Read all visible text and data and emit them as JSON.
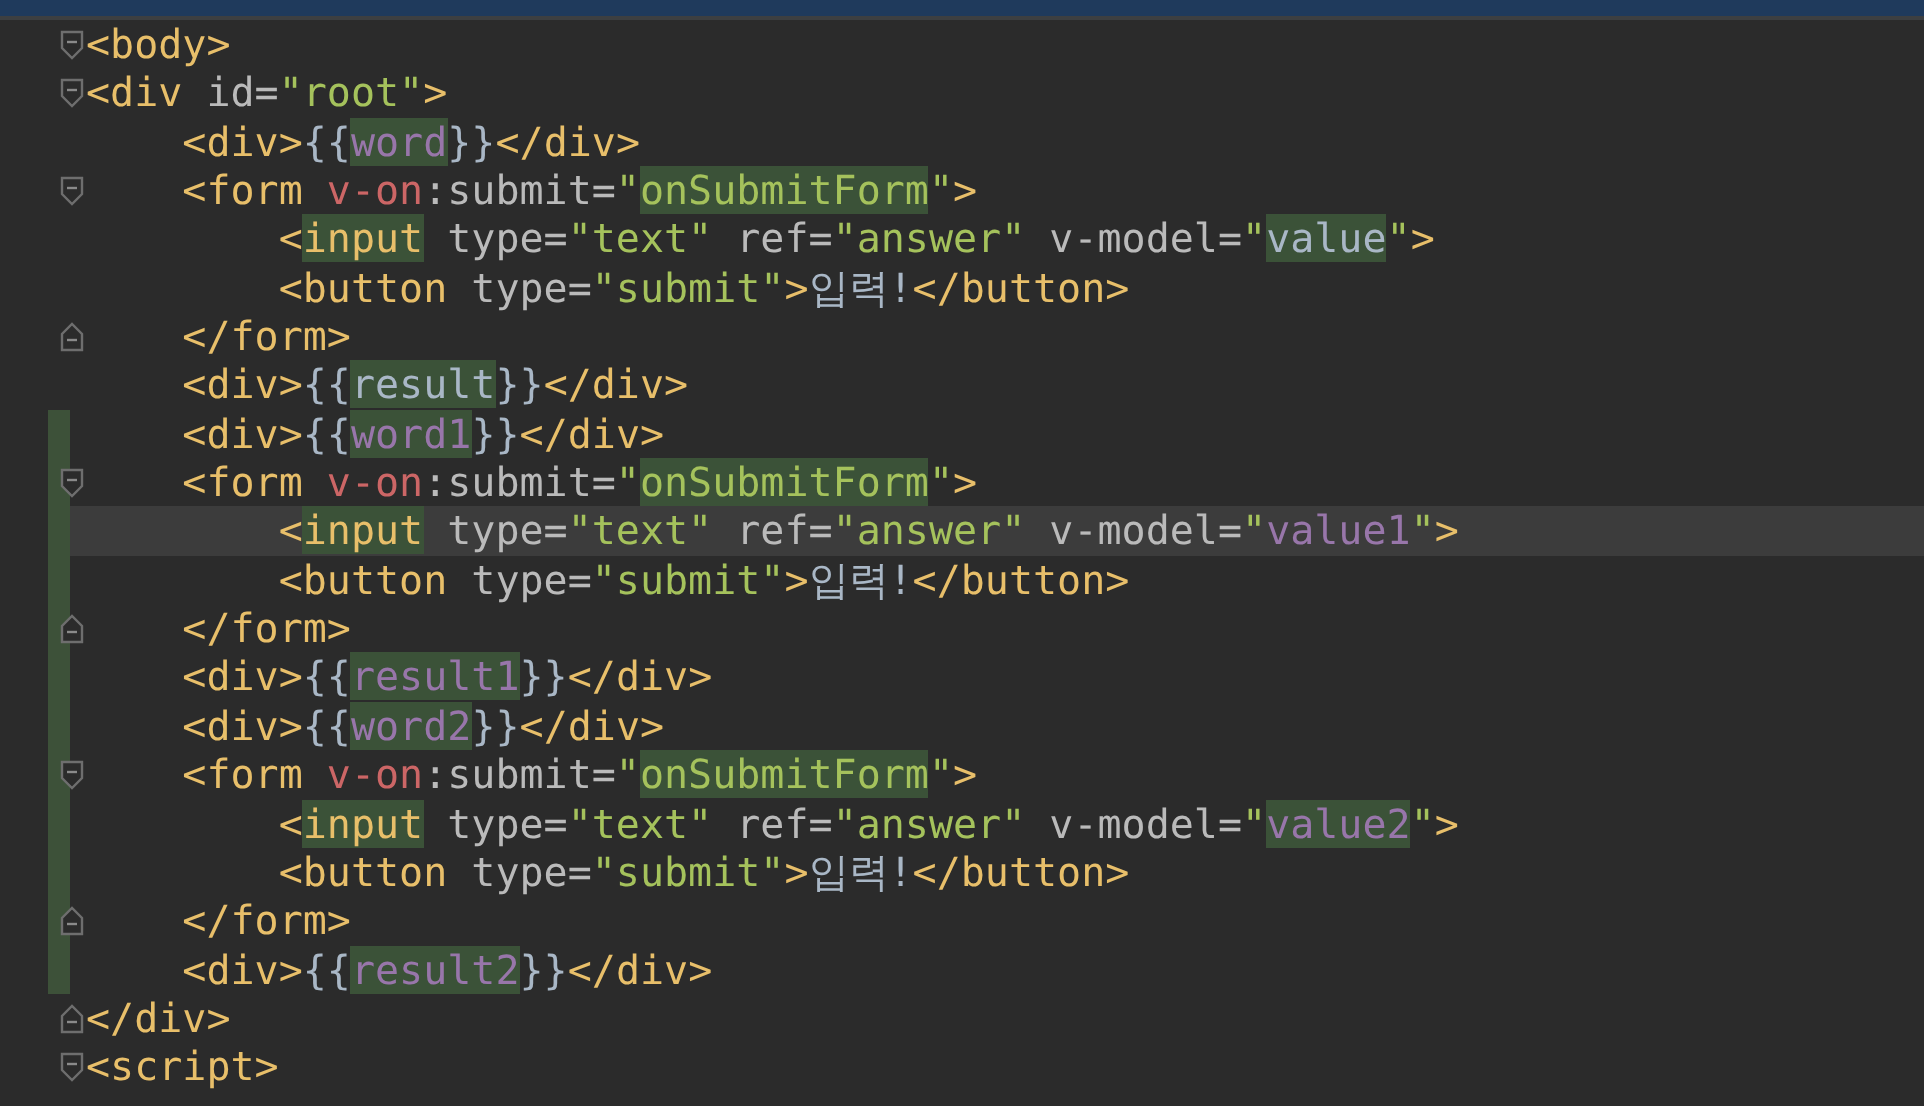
{
  "editor": {
    "lines": [
      {
        "fold_start": true,
        "fold_end": false,
        "changed": false,
        "current": false,
        "tokens": [
          {
            "kind": "tag",
            "text": "<body>"
          }
        ]
      },
      {
        "fold_start": true,
        "fold_end": false,
        "changed": false,
        "current": false,
        "tokens": [
          {
            "kind": "tag",
            "text": "<div "
          },
          {
            "kind": "attr",
            "text": "id="
          },
          {
            "kind": "string",
            "text": "\"root\""
          },
          {
            "kind": "tag",
            "text": ">"
          }
        ]
      },
      {
        "fold_start": false,
        "fold_end": false,
        "changed": false,
        "current": false,
        "tokens": [
          {
            "kind": "tag",
            "text": "    <div>"
          },
          {
            "kind": "plain",
            "text": "{{"
          },
          {
            "kind": "var",
            "text": "word",
            "highlighted": true
          },
          {
            "kind": "plain",
            "text": "}}"
          },
          {
            "kind": "tag",
            "text": "</div>"
          }
        ]
      },
      {
        "fold_start": true,
        "fold_end": false,
        "changed": false,
        "current": false,
        "tokens": [
          {
            "kind": "tag",
            "text": "    <form "
          },
          {
            "kind": "directive",
            "text": "v-on"
          },
          {
            "kind": "attr",
            "text": ":submit="
          },
          {
            "kind": "string",
            "text": "\""
          },
          {
            "kind": "string",
            "text": "onSubmitForm",
            "highlighted": true
          },
          {
            "kind": "string",
            "text": "\""
          },
          {
            "kind": "tag",
            "text": ">"
          }
        ]
      },
      {
        "fold_start": false,
        "fold_end": false,
        "changed": false,
        "current": false,
        "tokens": [
          {
            "kind": "tag",
            "text": "        <"
          },
          {
            "kind": "tag",
            "text": "input",
            "highlighted": true
          },
          {
            "kind": "attr",
            "text": " type="
          },
          {
            "kind": "string",
            "text": "\"text\""
          },
          {
            "kind": "attr",
            "text": " ref="
          },
          {
            "kind": "string",
            "text": "\"answer\""
          },
          {
            "kind": "attr",
            "text": " v-model="
          },
          {
            "kind": "string",
            "text": "\""
          },
          {
            "kind": "plain",
            "text": "value",
            "highlighted": true
          },
          {
            "kind": "string",
            "text": "\""
          },
          {
            "kind": "tag",
            "text": ">"
          }
        ]
      },
      {
        "fold_start": false,
        "fold_end": false,
        "changed": false,
        "current": false,
        "tokens": [
          {
            "kind": "tag",
            "text": "        <button "
          },
          {
            "kind": "attr",
            "text": "type="
          },
          {
            "kind": "string",
            "text": "\"submit\""
          },
          {
            "kind": "tag",
            "text": ">"
          },
          {
            "kind": "plain",
            "text": "입력!"
          },
          {
            "kind": "tag",
            "text": "</button>"
          }
        ]
      },
      {
        "fold_start": false,
        "fold_end": true,
        "changed": false,
        "current": false,
        "tokens": [
          {
            "kind": "tag",
            "text": "    </form>"
          }
        ]
      },
      {
        "fold_start": false,
        "fold_end": false,
        "changed": false,
        "current": false,
        "tokens": [
          {
            "kind": "tag",
            "text": "    <div>"
          },
          {
            "kind": "plain",
            "text": "{{"
          },
          {
            "kind": "plain",
            "text": "result",
            "highlighted": true
          },
          {
            "kind": "plain",
            "text": "}}"
          },
          {
            "kind": "tag",
            "text": "</div>"
          }
        ]
      },
      {
        "fold_start": false,
        "fold_end": false,
        "changed": true,
        "current": false,
        "tokens": [
          {
            "kind": "tag",
            "text": "    <div>"
          },
          {
            "kind": "plain",
            "text": "{{"
          },
          {
            "kind": "var",
            "text": "word1",
            "highlighted": true
          },
          {
            "kind": "plain",
            "text": "}}"
          },
          {
            "kind": "tag",
            "text": "</div>"
          }
        ]
      },
      {
        "fold_start": true,
        "fold_end": false,
        "changed": true,
        "current": false,
        "tokens": [
          {
            "kind": "tag",
            "text": "    <form "
          },
          {
            "kind": "directive",
            "text": "v-on"
          },
          {
            "kind": "attr",
            "text": ":submit="
          },
          {
            "kind": "string",
            "text": "\""
          },
          {
            "kind": "string",
            "text": "onSubmitForm",
            "highlighted": true
          },
          {
            "kind": "string",
            "text": "\""
          },
          {
            "kind": "tag",
            "text": ">"
          }
        ]
      },
      {
        "fold_start": false,
        "fold_end": false,
        "changed": true,
        "current": true,
        "tokens": [
          {
            "kind": "tag",
            "text": "        <"
          },
          {
            "kind": "tag",
            "text": "input",
            "highlighted": true
          },
          {
            "kind": "attr",
            "text": " type="
          },
          {
            "kind": "string",
            "text": "\"text\""
          },
          {
            "kind": "attr",
            "text": " ref="
          },
          {
            "kind": "string",
            "text": "\"answer\""
          },
          {
            "kind": "attr",
            "text": " v-model="
          },
          {
            "kind": "string",
            "text": "\""
          },
          {
            "kind": "var",
            "text": "value1"
          },
          {
            "kind": "string",
            "text": "\""
          },
          {
            "kind": "tag",
            "text": ">"
          }
        ]
      },
      {
        "fold_start": false,
        "fold_end": false,
        "changed": true,
        "current": false,
        "tokens": [
          {
            "kind": "tag",
            "text": "        <button "
          },
          {
            "kind": "attr",
            "text": "type="
          },
          {
            "kind": "string",
            "text": "\"submit\""
          },
          {
            "kind": "tag",
            "text": ">"
          },
          {
            "kind": "plain",
            "text": "입력!"
          },
          {
            "kind": "tag",
            "text": "</button>"
          }
        ]
      },
      {
        "fold_start": false,
        "fold_end": true,
        "changed": true,
        "current": false,
        "tokens": [
          {
            "kind": "tag",
            "text": "    </form>"
          }
        ]
      },
      {
        "fold_start": false,
        "fold_end": false,
        "changed": true,
        "current": false,
        "tokens": [
          {
            "kind": "tag",
            "text": "    <div>"
          },
          {
            "kind": "plain",
            "text": "{{"
          },
          {
            "kind": "var",
            "text": "result1",
            "highlighted": true
          },
          {
            "kind": "plain",
            "text": "}}"
          },
          {
            "kind": "tag",
            "text": "</div>"
          }
        ]
      },
      {
        "fold_start": false,
        "fold_end": false,
        "changed": true,
        "current": false,
        "tokens": [
          {
            "kind": "tag",
            "text": "    <div>"
          },
          {
            "kind": "plain",
            "text": "{{"
          },
          {
            "kind": "var",
            "text": "word2",
            "highlighted": true
          },
          {
            "kind": "plain",
            "text": "}}"
          },
          {
            "kind": "tag",
            "text": "</div>"
          }
        ]
      },
      {
        "fold_start": true,
        "fold_end": false,
        "changed": true,
        "current": false,
        "tokens": [
          {
            "kind": "tag",
            "text": "    <form "
          },
          {
            "kind": "directive",
            "text": "v-on"
          },
          {
            "kind": "attr",
            "text": ":submit="
          },
          {
            "kind": "string",
            "text": "\""
          },
          {
            "kind": "string",
            "text": "onSubmitForm",
            "highlighted": true
          },
          {
            "kind": "string",
            "text": "\""
          },
          {
            "kind": "tag",
            "text": ">"
          }
        ]
      },
      {
        "fold_start": false,
        "fold_end": false,
        "changed": true,
        "current": false,
        "tokens": [
          {
            "kind": "tag",
            "text": "        <"
          },
          {
            "kind": "tag",
            "text": "input",
            "highlighted": true
          },
          {
            "kind": "attr",
            "text": " type="
          },
          {
            "kind": "string",
            "text": "\"text\""
          },
          {
            "kind": "attr",
            "text": " ref="
          },
          {
            "kind": "string",
            "text": "\"answer\""
          },
          {
            "kind": "attr",
            "text": " v-model="
          },
          {
            "kind": "string",
            "text": "\""
          },
          {
            "kind": "var",
            "text": "value2",
            "highlighted": true
          },
          {
            "kind": "string",
            "text": "\""
          },
          {
            "kind": "tag",
            "text": ">"
          }
        ]
      },
      {
        "fold_start": false,
        "fold_end": false,
        "changed": true,
        "current": false,
        "tokens": [
          {
            "kind": "tag",
            "text": "        <button "
          },
          {
            "kind": "attr",
            "text": "type="
          },
          {
            "kind": "string",
            "text": "\"submit\""
          },
          {
            "kind": "tag",
            "text": ">"
          },
          {
            "kind": "plain",
            "text": "입력!"
          },
          {
            "kind": "tag",
            "text": "</button>"
          }
        ]
      },
      {
        "fold_start": false,
        "fold_end": true,
        "changed": true,
        "current": false,
        "tokens": [
          {
            "kind": "tag",
            "text": "    </form>"
          }
        ]
      },
      {
        "fold_start": false,
        "fold_end": false,
        "changed": true,
        "current": false,
        "tokens": [
          {
            "kind": "tag",
            "text": "    <div>"
          },
          {
            "kind": "plain",
            "text": "{{"
          },
          {
            "kind": "var",
            "text": "result2",
            "highlighted": true
          },
          {
            "kind": "plain",
            "text": "}}"
          },
          {
            "kind": "tag",
            "text": "</div>"
          }
        ]
      },
      {
        "fold_start": false,
        "fold_end": true,
        "changed": false,
        "current": false,
        "tokens": [
          {
            "kind": "tag",
            "text": "</div>"
          }
        ]
      },
      {
        "fold_start": true,
        "fold_end": false,
        "changed": false,
        "current": false,
        "tokens": [
          {
            "kind": "tag",
            "text": "<script>"
          }
        ]
      }
    ]
  }
}
